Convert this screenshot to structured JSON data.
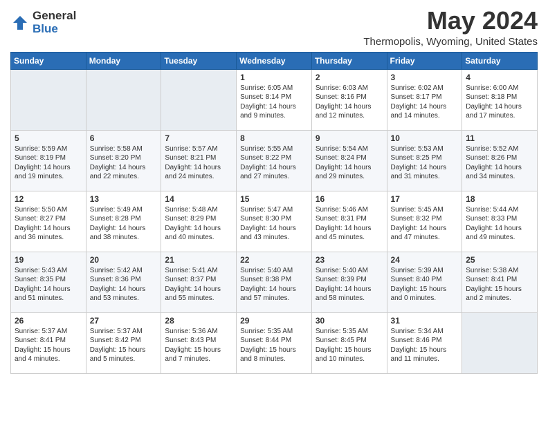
{
  "logo": {
    "general": "General",
    "blue": "Blue"
  },
  "title": "May 2024",
  "location": "Thermopolis, Wyoming, United States",
  "days_of_week": [
    "Sunday",
    "Monday",
    "Tuesday",
    "Wednesday",
    "Thursday",
    "Friday",
    "Saturday"
  ],
  "weeks": [
    [
      {
        "day": "",
        "content": ""
      },
      {
        "day": "",
        "content": ""
      },
      {
        "day": "",
        "content": ""
      },
      {
        "day": "1",
        "content": "Sunrise: 6:05 AM\nSunset: 8:14 PM\nDaylight: 14 hours\nand 9 minutes."
      },
      {
        "day": "2",
        "content": "Sunrise: 6:03 AM\nSunset: 8:16 PM\nDaylight: 14 hours\nand 12 minutes."
      },
      {
        "day": "3",
        "content": "Sunrise: 6:02 AM\nSunset: 8:17 PM\nDaylight: 14 hours\nand 14 minutes."
      },
      {
        "day": "4",
        "content": "Sunrise: 6:00 AM\nSunset: 8:18 PM\nDaylight: 14 hours\nand 17 minutes."
      }
    ],
    [
      {
        "day": "5",
        "content": "Sunrise: 5:59 AM\nSunset: 8:19 PM\nDaylight: 14 hours\nand 19 minutes."
      },
      {
        "day": "6",
        "content": "Sunrise: 5:58 AM\nSunset: 8:20 PM\nDaylight: 14 hours\nand 22 minutes."
      },
      {
        "day": "7",
        "content": "Sunrise: 5:57 AM\nSunset: 8:21 PM\nDaylight: 14 hours\nand 24 minutes."
      },
      {
        "day": "8",
        "content": "Sunrise: 5:55 AM\nSunset: 8:22 PM\nDaylight: 14 hours\nand 27 minutes."
      },
      {
        "day": "9",
        "content": "Sunrise: 5:54 AM\nSunset: 8:24 PM\nDaylight: 14 hours\nand 29 minutes."
      },
      {
        "day": "10",
        "content": "Sunrise: 5:53 AM\nSunset: 8:25 PM\nDaylight: 14 hours\nand 31 minutes."
      },
      {
        "day": "11",
        "content": "Sunrise: 5:52 AM\nSunset: 8:26 PM\nDaylight: 14 hours\nand 34 minutes."
      }
    ],
    [
      {
        "day": "12",
        "content": "Sunrise: 5:50 AM\nSunset: 8:27 PM\nDaylight: 14 hours\nand 36 minutes."
      },
      {
        "day": "13",
        "content": "Sunrise: 5:49 AM\nSunset: 8:28 PM\nDaylight: 14 hours\nand 38 minutes."
      },
      {
        "day": "14",
        "content": "Sunrise: 5:48 AM\nSunset: 8:29 PM\nDaylight: 14 hours\nand 40 minutes."
      },
      {
        "day": "15",
        "content": "Sunrise: 5:47 AM\nSunset: 8:30 PM\nDaylight: 14 hours\nand 43 minutes."
      },
      {
        "day": "16",
        "content": "Sunrise: 5:46 AM\nSunset: 8:31 PM\nDaylight: 14 hours\nand 45 minutes."
      },
      {
        "day": "17",
        "content": "Sunrise: 5:45 AM\nSunset: 8:32 PM\nDaylight: 14 hours\nand 47 minutes."
      },
      {
        "day": "18",
        "content": "Sunrise: 5:44 AM\nSunset: 8:33 PM\nDaylight: 14 hours\nand 49 minutes."
      }
    ],
    [
      {
        "day": "19",
        "content": "Sunrise: 5:43 AM\nSunset: 8:35 PM\nDaylight: 14 hours\nand 51 minutes."
      },
      {
        "day": "20",
        "content": "Sunrise: 5:42 AM\nSunset: 8:36 PM\nDaylight: 14 hours\nand 53 minutes."
      },
      {
        "day": "21",
        "content": "Sunrise: 5:41 AM\nSunset: 8:37 PM\nDaylight: 14 hours\nand 55 minutes."
      },
      {
        "day": "22",
        "content": "Sunrise: 5:40 AM\nSunset: 8:38 PM\nDaylight: 14 hours\nand 57 minutes."
      },
      {
        "day": "23",
        "content": "Sunrise: 5:40 AM\nSunset: 8:39 PM\nDaylight: 14 hours\nand 58 minutes."
      },
      {
        "day": "24",
        "content": "Sunrise: 5:39 AM\nSunset: 8:40 PM\nDaylight: 15 hours\nand 0 minutes."
      },
      {
        "day": "25",
        "content": "Sunrise: 5:38 AM\nSunset: 8:41 PM\nDaylight: 15 hours\nand 2 minutes."
      }
    ],
    [
      {
        "day": "26",
        "content": "Sunrise: 5:37 AM\nSunset: 8:41 PM\nDaylight: 15 hours\nand 4 minutes."
      },
      {
        "day": "27",
        "content": "Sunrise: 5:37 AM\nSunset: 8:42 PM\nDaylight: 15 hours\nand 5 minutes."
      },
      {
        "day": "28",
        "content": "Sunrise: 5:36 AM\nSunset: 8:43 PM\nDaylight: 15 hours\nand 7 minutes."
      },
      {
        "day": "29",
        "content": "Sunrise: 5:35 AM\nSunset: 8:44 PM\nDaylight: 15 hours\nand 8 minutes."
      },
      {
        "day": "30",
        "content": "Sunrise: 5:35 AM\nSunset: 8:45 PM\nDaylight: 15 hours\nand 10 minutes."
      },
      {
        "day": "31",
        "content": "Sunrise: 5:34 AM\nSunset: 8:46 PM\nDaylight: 15 hours\nand 11 minutes."
      },
      {
        "day": "",
        "content": ""
      }
    ]
  ]
}
